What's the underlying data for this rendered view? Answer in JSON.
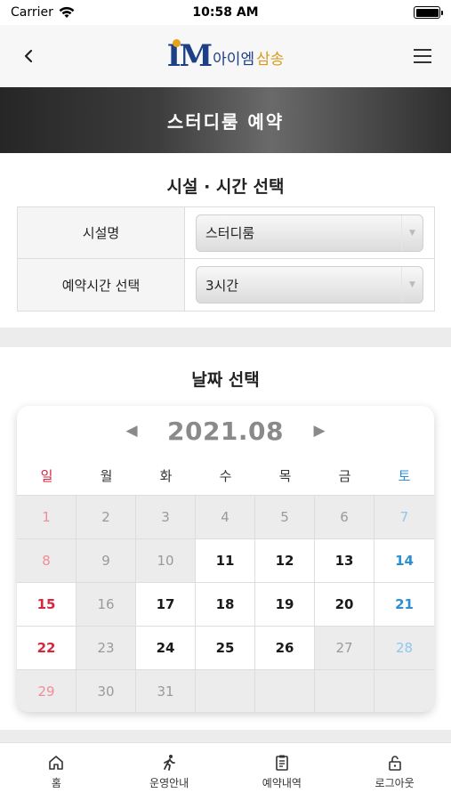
{
  "status_bar": {
    "carrier": "Carrier",
    "time": "10:58 AM"
  },
  "header": {
    "logo_mark": "IM",
    "logo_aim": "아이엠",
    "logo_samsong": "삼송"
  },
  "banner": {
    "title": "스터디룸 예약"
  },
  "facility": {
    "title": "시설 · 시간 선택",
    "rows": [
      {
        "label": "시설명",
        "value": "스터디룸"
      },
      {
        "label": "예약시간 선택",
        "value": "3시간"
      }
    ]
  },
  "date": {
    "title": "날짜 선택",
    "month": "2021.08",
    "weekdays": [
      "일",
      "월",
      "화",
      "수",
      "목",
      "금",
      "토"
    ],
    "weeks": [
      [
        "1",
        "2",
        "3",
        "4",
        "5",
        "6",
        "7"
      ],
      [
        "8",
        "9",
        "10",
        "11",
        "12",
        "13",
        "14"
      ],
      [
        "15",
        "16",
        "17",
        "18",
        "19",
        "20",
        "21"
      ],
      [
        "22",
        "23",
        "24",
        "25",
        "26",
        "27",
        "28"
      ],
      [
        "29",
        "30",
        "31",
        "",
        "",
        "",
        ""
      ]
    ],
    "available_days": [
      "11",
      "12",
      "13",
      "14",
      "15",
      "17",
      "18",
      "19",
      "20",
      "21",
      "22",
      "24",
      "25",
      "26"
    ]
  },
  "bottom_nav": [
    {
      "label": "홈",
      "icon": "home-icon"
    },
    {
      "label": "운영안내",
      "icon": "walk-icon"
    },
    {
      "label": "예약내역",
      "icon": "clipboard-icon"
    },
    {
      "label": "로그아웃",
      "icon": "unlock-icon"
    }
  ],
  "colors": {
    "sunday": "#d7263d",
    "saturday": "#2a8fd6",
    "brand_blue": "#1d3f86",
    "brand_gold": "#d99a1c"
  }
}
